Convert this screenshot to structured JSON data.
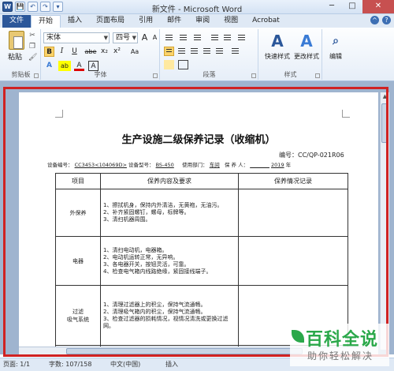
{
  "window": {
    "title": "新文件 - Microsoft Word",
    "controls": [
      "─",
      "□",
      "✕"
    ]
  },
  "quick_access": [
    "W",
    "💾",
    "↶",
    "↷",
    "▾"
  ],
  "tabs": [
    "文件",
    "开始",
    "插入",
    "页面布局",
    "引用",
    "邮件",
    "审阅",
    "视图",
    "Acrobat"
  ],
  "ribbon": {
    "clipboard": {
      "paste_label": "粘贴",
      "group_label": "剪贴板"
    },
    "font": {
      "font_name": "宋体",
      "font_size": "四号",
      "grow": "A",
      "shrink": "A",
      "clear": "Aa",
      "bold": "B",
      "italic": "I",
      "underline": "U",
      "strike": "abe",
      "sub": "x₂",
      "sup": "x²",
      "effects": "A",
      "highlight": "ab",
      "color": "A",
      "char_border": "A",
      "group_label": "字体"
    },
    "paragraph": {
      "group_label": "段落"
    },
    "styles": {
      "quick_label": "快速样式",
      "change_label": "更改样式",
      "group_label": "样式"
    },
    "editing": {
      "label": "编辑"
    }
  },
  "document": {
    "title": "生产设施二级保养记录（收缩机）",
    "number": "编号：CC/QP-021R06",
    "meta": {
      "equip_no_label": "设备编号：",
      "equip_no": "CC3453<104069D>",
      "model_label": "设备型号：",
      "model": "BS-450",
      "dept_label": "使用部门：",
      "dept": "车间",
      "keeper_label": "保 养 人：",
      "year": "2019",
      "year_suffix": "年"
    },
    "table": {
      "headers": [
        "项目",
        "保养内容及要求",
        "保养情况记录"
      ],
      "rows": [
        {
          "category": "外保养",
          "items": [
            "1、擦拭机身，保持内外清洁，无黄袍，无油污。",
            "2、补齐紧固螺钉，螺母，标牌等。",
            "3、清扫机器周围。"
          ]
        },
        {
          "category": "电器",
          "items": [
            "1、清扫电动机，电器箱。",
            "2、电动机运转正常，无异响。",
            "3、各电器开关，按钮灵活，可靠。",
            "4、检查电气箱内线路绝缘，紧固接线端子。"
          ]
        },
        {
          "category": "过滤\n吸气系统",
          "items": [
            "1、清理过滤器上的积尘，保持气流通畅。",
            "2、清理吸气箱内的积尘，保持气流通畅。",
            "3、检查过滤器的损耗情况，视情况清洗或更换过滤网。"
          ]
        },
        {
          "category": "",
          "items": []
        }
      ]
    }
  },
  "status": {
    "page": "页面: 1/1",
    "words": "字数: 107/158",
    "lang": "中文(中国)",
    "mode": "插入"
  },
  "watermark": {
    "main": "百科全说",
    "sub": "助你轻松解决"
  }
}
